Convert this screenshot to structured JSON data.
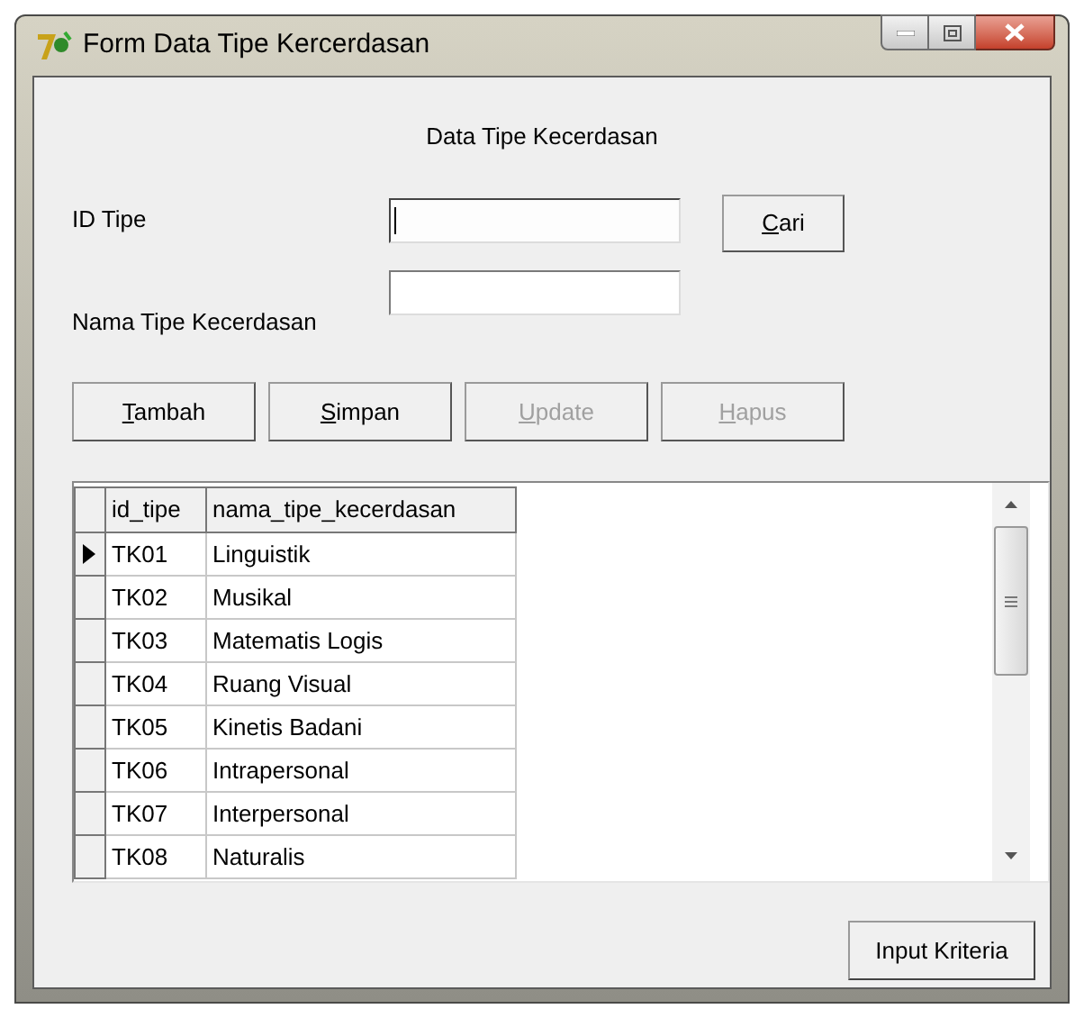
{
  "window": {
    "title": "Form Data Tipe Kercerdasan"
  },
  "heading": "Data Tipe Kecerdasan",
  "fields": [
    {
      "label": "ID Tipe",
      "focused": true
    },
    {
      "label": "Nama Tipe Kecerdasan",
      "focused": false
    }
  ],
  "search_button": {
    "mnemonic": "C",
    "label_rest": "ari",
    "disabled": false
  },
  "buttons": [
    {
      "mnemonic": "T",
      "label_rest": "ambah",
      "disabled": false
    },
    {
      "mnemonic": "S",
      "label_rest": "impan",
      "disabled": false
    },
    {
      "mnemonic": "U",
      "label_rest": "pdate",
      "disabled": true
    },
    {
      "mnemonic": "H",
      "label_rest": "apus",
      "disabled": true
    }
  ],
  "table": {
    "columns": [
      "id_tipe",
      "nama_tipe_kecerdasan"
    ],
    "rows": [
      {
        "cells": [
          "TK01",
          "Linguistik"
        ],
        "selected": true
      },
      {
        "cells": [
          "TK02",
          "Musikal"
        ],
        "selected": false
      },
      {
        "cells": [
          "TK03",
          "Matematis Logis"
        ],
        "selected": false
      },
      {
        "cells": [
          "TK04",
          "Ruang Visual"
        ],
        "selected": false
      },
      {
        "cells": [
          "TK05",
          "Kinetis Badani"
        ],
        "selected": false
      },
      {
        "cells": [
          "TK06",
          "Intrapersonal"
        ],
        "selected": false
      },
      {
        "cells": [
          "TK07",
          "Interpersonal"
        ],
        "selected": false
      },
      {
        "cells": [
          "TK08",
          "Naturalis"
        ],
        "selected": false
      }
    ]
  },
  "footer_button": {
    "label": "Input Kriteria"
  }
}
